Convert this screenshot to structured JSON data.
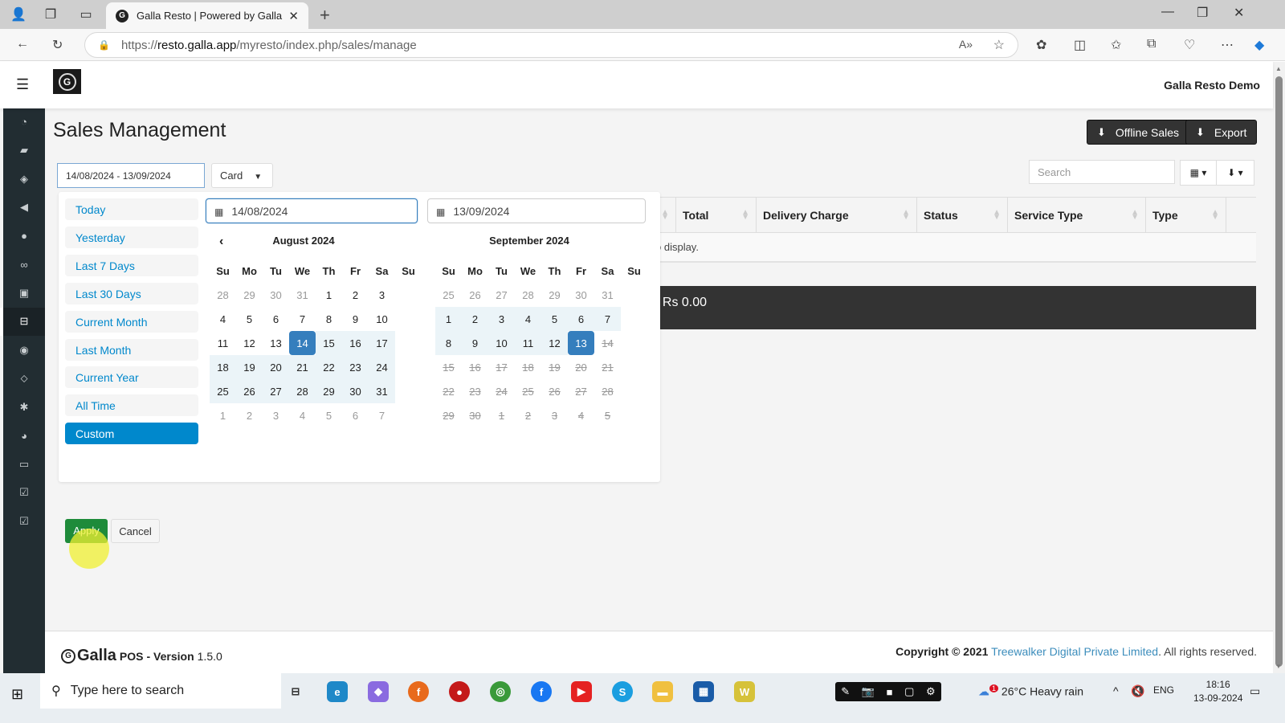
{
  "browser": {
    "tab_title": "Galla Resto | Powered by Galla",
    "url_prefix": "https://",
    "url_host": "resto.galla.app",
    "url_path": "/myresto/index.php/sales/manage"
  },
  "app": {
    "user_name": "Galla Resto Demo",
    "page_title": "Sales Management",
    "offline_sales_label": "Offline Sales",
    "export_label": "Export",
    "date_range_value": "14/08/2024 - 13/09/2024",
    "payment_filter": "Card",
    "search_placeholder": "Search",
    "sidebar_icons": [
      "dashboard-icon",
      "folder-icon",
      "cube-icon",
      "bullhorn-icon",
      "user-circle-icon",
      "handshake-icon",
      "gift-icon",
      "shopping-basket-icon",
      "users-icon",
      "map-marker-icon",
      "gear-icon",
      "pie-chart-icon",
      "money-icon",
      "check-square-icon",
      "check-square-icon"
    ],
    "sidebar_active_index": 7
  },
  "table": {
    "columns": [
      "Total",
      "Delivery Charge",
      "Status",
      "Service Type",
      "Type"
    ],
    "empty_message": "o display.",
    "total_text": ": Rs 0.00"
  },
  "picker": {
    "ranges": [
      "Today",
      "Yesterday",
      "Last 7 Days",
      "Last 30 Days",
      "Current Month",
      "Last Month",
      "Current Year",
      "All Time",
      "Custom"
    ],
    "active_range": "Custom",
    "apply_label": "Apply",
    "cancel_label": "Cancel",
    "start_input": "14/08/2024",
    "end_input": "13/09/2024",
    "weekdays": [
      "Su",
      "Mo",
      "Tu",
      "We",
      "Th",
      "Fr",
      "Sa",
      "Su"
    ],
    "left_month": {
      "title": "August 2024",
      "weeks": [
        [
          {
            "d": "28",
            "s": "off"
          },
          {
            "d": "29",
            "s": "off"
          },
          {
            "d": "30",
            "s": "off"
          },
          {
            "d": "31",
            "s": "off"
          },
          {
            "d": "1"
          },
          {
            "d": "2"
          },
          {
            "d": "3"
          }
        ],
        [
          {
            "d": "4"
          },
          {
            "d": "5"
          },
          {
            "d": "6"
          },
          {
            "d": "7"
          },
          {
            "d": "8"
          },
          {
            "d": "9"
          },
          {
            "d": "10"
          }
        ],
        [
          {
            "d": "11"
          },
          {
            "d": "12"
          },
          {
            "d": "13"
          },
          {
            "d": "14",
            "s": "sel"
          },
          {
            "d": "15",
            "s": "inr"
          },
          {
            "d": "16",
            "s": "inr"
          },
          {
            "d": "17",
            "s": "inr"
          }
        ],
        [
          {
            "d": "18",
            "s": "inr"
          },
          {
            "d": "19",
            "s": "inr"
          },
          {
            "d": "20",
            "s": "inr"
          },
          {
            "d": "21",
            "s": "inr"
          },
          {
            "d": "22",
            "s": "inr"
          },
          {
            "d": "23",
            "s": "inr"
          },
          {
            "d": "24",
            "s": "inr"
          }
        ],
        [
          {
            "d": "25",
            "s": "inr"
          },
          {
            "d": "26",
            "s": "inr"
          },
          {
            "d": "27",
            "s": "inr"
          },
          {
            "d": "28",
            "s": "inr"
          },
          {
            "d": "29",
            "s": "inr"
          },
          {
            "d": "30",
            "s": "inr"
          },
          {
            "d": "31",
            "s": "inr"
          }
        ],
        [
          {
            "d": "1",
            "s": "off"
          },
          {
            "d": "2",
            "s": "off"
          },
          {
            "d": "3",
            "s": "off"
          },
          {
            "d": "4",
            "s": "off"
          },
          {
            "d": "5",
            "s": "off"
          },
          {
            "d": "6",
            "s": "off"
          },
          {
            "d": "7",
            "s": "off"
          }
        ]
      ]
    },
    "right_month": {
      "title": "September 2024",
      "weeks": [
        [
          {
            "d": "25",
            "s": "off"
          },
          {
            "d": "26",
            "s": "off"
          },
          {
            "d": "27",
            "s": "off"
          },
          {
            "d": "28",
            "s": "off"
          },
          {
            "d": "29",
            "s": "off"
          },
          {
            "d": "30",
            "s": "off"
          },
          {
            "d": "31",
            "s": "off"
          }
        ],
        [
          {
            "d": "1",
            "s": "inr"
          },
          {
            "d": "2",
            "s": "inr"
          },
          {
            "d": "3",
            "s": "inr"
          },
          {
            "d": "4",
            "s": "inr"
          },
          {
            "d": "5",
            "s": "inr"
          },
          {
            "d": "6",
            "s": "inr"
          },
          {
            "d": "7",
            "s": "inr"
          }
        ],
        [
          {
            "d": "8",
            "s": "inr"
          },
          {
            "d": "9",
            "s": "inr"
          },
          {
            "d": "10",
            "s": "inr"
          },
          {
            "d": "11",
            "s": "inr"
          },
          {
            "d": "12",
            "s": "inr"
          },
          {
            "d": "13",
            "s": "sel"
          },
          {
            "d": "14",
            "s": "dis"
          }
        ],
        [
          {
            "d": "15",
            "s": "dis"
          },
          {
            "d": "16",
            "s": "dis"
          },
          {
            "d": "17",
            "s": "dis"
          },
          {
            "d": "18",
            "s": "dis"
          },
          {
            "d": "19",
            "s": "dis"
          },
          {
            "d": "20",
            "s": "dis"
          },
          {
            "d": "21",
            "s": "dis"
          }
        ],
        [
          {
            "d": "22",
            "s": "dis"
          },
          {
            "d": "23",
            "s": "dis"
          },
          {
            "d": "24",
            "s": "dis"
          },
          {
            "d": "25",
            "s": "dis"
          },
          {
            "d": "26",
            "s": "dis"
          },
          {
            "d": "27",
            "s": "dis"
          },
          {
            "d": "28",
            "s": "dis"
          }
        ],
        [
          {
            "d": "29",
            "s": "dis"
          },
          {
            "d": "30",
            "s": "dis"
          },
          {
            "d": "1",
            "s": "dis"
          },
          {
            "d": "2",
            "s": "dis"
          },
          {
            "d": "3",
            "s": "dis"
          },
          {
            "d": "4",
            "s": "dis"
          },
          {
            "d": "5",
            "s": "dis"
          }
        ]
      ]
    }
  },
  "footer": {
    "brand": "Galla",
    "pos": "POS",
    "version_label": "- Version",
    "version": "1.5.0",
    "copyright": "Copyright © 2021",
    "company": "Treewalker Digital Private Limited",
    "rights": ". All rights reserved."
  },
  "taskbar": {
    "search_placeholder": "Type here to search",
    "weather": "26°C  Heavy rain",
    "weather_badge": "1",
    "lang": "ENG",
    "time": "18:16",
    "date": "13-09-2024"
  },
  "colors": {
    "accent": "#0088cc",
    "selected_day": "#357ebd",
    "in_range": "#ebf4f8",
    "sidebar": "#222d32",
    "apply": "#1e8b3a"
  }
}
